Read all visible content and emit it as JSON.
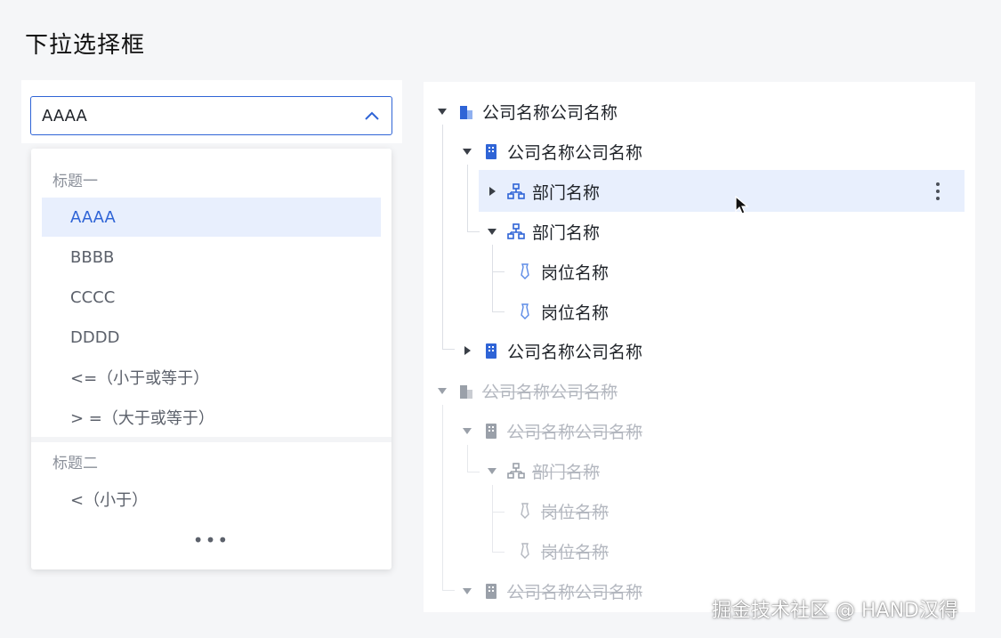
{
  "page": {
    "title": "下拉选择框"
  },
  "select": {
    "value": "AAAA",
    "groups": [
      {
        "title": "标题一",
        "options": [
          "AAAA",
          "BBBB",
          "CCCC",
          "DDDD",
          "<=（小于或等于）",
          "> =（大于或等于）"
        ]
      },
      {
        "title": "标题二",
        "options": [
          "<（小于）"
        ]
      }
    ],
    "selected_option": "AAAA",
    "more_label": "•••"
  },
  "tree": {
    "nodes": [
      {
        "label": "公司名称公司名称",
        "type": "company",
        "expanded": true,
        "disabled": false
      },
      {
        "label": "公司名称公司名称",
        "type": "building",
        "expanded": true,
        "disabled": false
      },
      {
        "label": "部门名称",
        "type": "department",
        "expanded": false,
        "disabled": false,
        "hovered": true
      },
      {
        "label": "部门名称",
        "type": "department",
        "expanded": true,
        "disabled": false
      },
      {
        "label": "岗位名称",
        "type": "position",
        "disabled": false
      },
      {
        "label": "岗位名称",
        "type": "position",
        "disabled": false
      },
      {
        "label": "公司名称公司名称",
        "type": "building",
        "expanded": false,
        "disabled": false
      },
      {
        "label": "公司名称公司名称",
        "type": "company",
        "expanded": true,
        "disabled": true
      },
      {
        "label": "公司名称公司名称",
        "type": "building",
        "expanded": true,
        "disabled": true
      },
      {
        "label": "部门名称",
        "type": "department",
        "expanded": true,
        "disabled": true
      },
      {
        "label": "岗位名称",
        "type": "position",
        "disabled": true
      },
      {
        "label": "岗位名称",
        "type": "position",
        "disabled": true
      },
      {
        "label": "公司名称公司名称",
        "type": "building",
        "expanded": true,
        "disabled": true
      }
    ]
  },
  "colors": {
    "accent": "#2f64d6",
    "selected_bg": "#e8effd",
    "disabled_text": "#b3b7bf"
  },
  "watermark": "掘金技术社区 @ HAND汉得"
}
